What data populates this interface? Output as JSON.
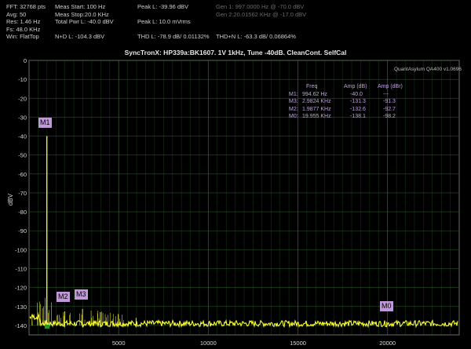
{
  "header": {
    "col1": [
      "FFT: 32768 pts",
      "Avg: 50",
      "Res: 1.46 Hz",
      "Fs: 48.0 KHz",
      "Win: FlatTop"
    ],
    "col2": [
      "Meas Start: 100 Hz",
      "Meas Stop:20.0 KHz",
      "Total Pwr L: -40.0 dBV",
      "",
      "N+D L: -104.3 dBV"
    ],
    "col3": [
      "Peak L: -39.96 dBV",
      "",
      "Peak L: 10.0 mVrms",
      "",
      "THD L: -78.9 dB/ 0.01132%"
    ],
    "col4": [
      "Gen 1: 997.0000 Hz @ -70.0  dBV",
      "Gen 2:20.01562 KHz @ -17.0  dBV",
      "",
      "",
      "THD+N L: -63.3 dB/ 0.06864%"
    ]
  },
  "plot": {
    "title": "SyncTronX: HP339a:BK1607. 1V 1kHz, Tune -40dB. CleanCont. SelfCal",
    "version": "QuantAsylum QA400 v1.0696",
    "ylabel": "dBV"
  },
  "marker_table": {
    "headers": [
      "Freq",
      "Amp (dB)",
      "Amp (dBr)"
    ],
    "rows": [
      {
        "id": "M1:",
        "freq": "994.62 Hz",
        "amp_db": "-40.0",
        "amp_dbr": "---"
      },
      {
        "id": "M3:",
        "freq": "2.9824 KHz",
        "amp_db": "-131.3",
        "amp_dbr": "-91.3"
      },
      {
        "id": "M2:",
        "freq": "1.9877 KHz",
        "amp_db": "-132.6",
        "amp_dbr": "-92.7"
      },
      {
        "id": "M0:",
        "freq": "19.955 KHz",
        "amp_db": "-138.1",
        "amp_dbr": "-98.2"
      }
    ]
  },
  "markers": {
    "m1": "M1",
    "m2": "M2",
    "m3": "M3",
    "m0": "M0"
  },
  "colors": {
    "trace": "#ffff33",
    "grid": "#2a6a2a",
    "marker_bg": "#c09ad8",
    "background": "#000000"
  },
  "chart_data": {
    "type": "line",
    "xlabel": "",
    "ylabel": "dBV",
    "xlim": [
      0,
      24000
    ],
    "ylim": [
      -145,
      0
    ],
    "x_ticks": [
      5000,
      10000,
      15000,
      20000
    ],
    "y_ticks": [
      0,
      -10,
      -20,
      -30,
      -40,
      -50,
      -60,
      -70,
      -80,
      -90,
      -100,
      -110,
      -120,
      -130,
      -140
    ],
    "grid": true,
    "series": [
      {
        "noise_floor": -139,
        "x": [
          994.62,
          1987.7,
          2982.4,
          3980,
          4980,
          5970,
          19955
        ],
        "y": [
          -40.0,
          -132.6,
          -131.3,
          -133,
          -134,
          -136,
          -138.1
        ]
      }
    ],
    "markers": [
      {
        "name": "M1",
        "x": 994.62,
        "y": -40.0
      },
      {
        "name": "M2",
        "x": 1987.7,
        "y": -132.6
      },
      {
        "name": "M3",
        "x": 2982.4,
        "y": -131.3
      },
      {
        "name": "M0",
        "x": 19955,
        "y": -138.1
      }
    ]
  }
}
